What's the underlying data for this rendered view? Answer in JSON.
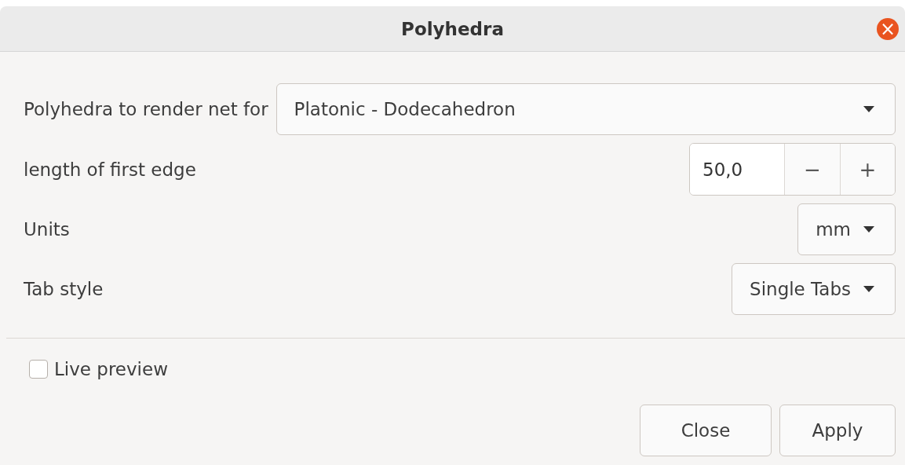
{
  "window": {
    "title": "Polyhedra",
    "close_glyph": "×"
  },
  "fields": [
    {
      "kind": "dropdown",
      "label": "Polyhedra to render net for",
      "value": "Platonic - Dodecahedron"
    },
    {
      "kind": "spin",
      "label": "length of first edge",
      "value": "50,0",
      "minus": "−",
      "plus": "+"
    },
    {
      "kind": "dropdown",
      "label": "Units",
      "value": "mm"
    },
    {
      "kind": "dropdown",
      "label": "Tab style",
      "value": "Single Tabs"
    }
  ],
  "live_preview": {
    "label": "Live preview",
    "checked": false
  },
  "buttons": [
    "Close",
    "Apply"
  ]
}
